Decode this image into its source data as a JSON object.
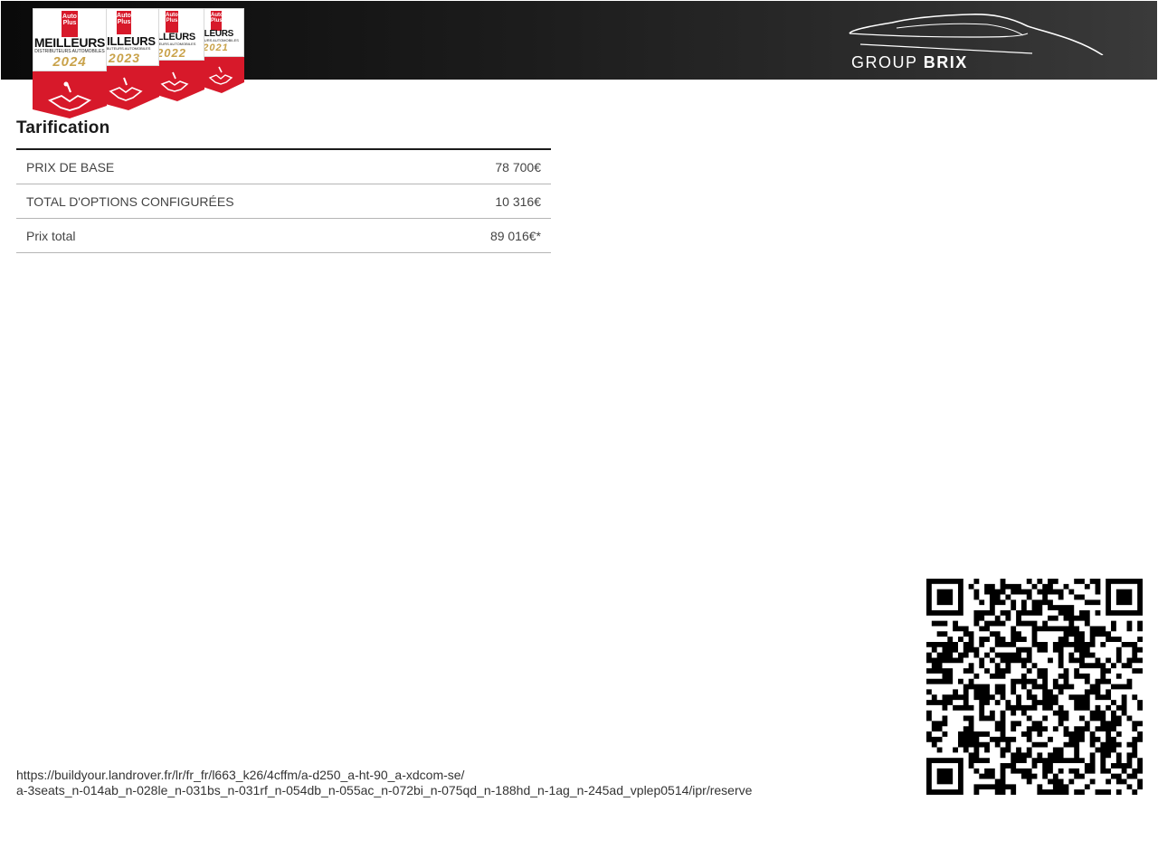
{
  "badges": [
    {
      "brand_line1": "Auto",
      "brand_line2": "Plus",
      "title": "MEILLEURS",
      "subtitle": "DISTRIBUTEURS AUTOMOBILES",
      "year": "2024"
    },
    {
      "brand_line1": "Auto",
      "brand_line2": "Plus",
      "title": "MEILLEURS",
      "subtitle": "DISTRIBUTEURS AUTOMOBILES",
      "year": "2023"
    },
    {
      "brand_line1": "Auto",
      "brand_line2": "Plus",
      "title": "MEILLEURS",
      "subtitle": "DISTRIBUTEURS AUTOMOBILES",
      "year": "2022"
    },
    {
      "brand_line1": "Auto",
      "brand_line2": "Plus",
      "title": "MEILLEURS",
      "subtitle": "DISTRIBUTEURS AUTOMOBILES",
      "year": "2021"
    }
  ],
  "logo": {
    "text_regular": "GROUP",
    "text_bold": "BRIX"
  },
  "pricing": {
    "title": "Tarification",
    "rows": [
      {
        "label": "PRIX DE BASE",
        "value": "78 700€"
      },
      {
        "label": "TOTAL D'OPTIONS CONFIGURÉES",
        "value": "10 316€"
      },
      {
        "label": "Prix total",
        "value": "89 016€*"
      }
    ]
  },
  "footer": {
    "url_line1": "https://buildyour.landrover.fr/lr/fr_fr/l663_k26/4cffm/a-d250_a-ht-90_a-xdcom-se/",
    "url_line2": "a-3seats_n-014ab_n-028le_n-031bs_n-031rf_n-054db_n-055ac_n-072bi_n-075qd_n-188hd_n-1ag_n-245ad_vplep0514/ipr/reserve"
  },
  "colors": {
    "badge_red": "#d7192a",
    "badge_gold": "#c9a24a",
    "header_dark": "#1c1c1c"
  }
}
